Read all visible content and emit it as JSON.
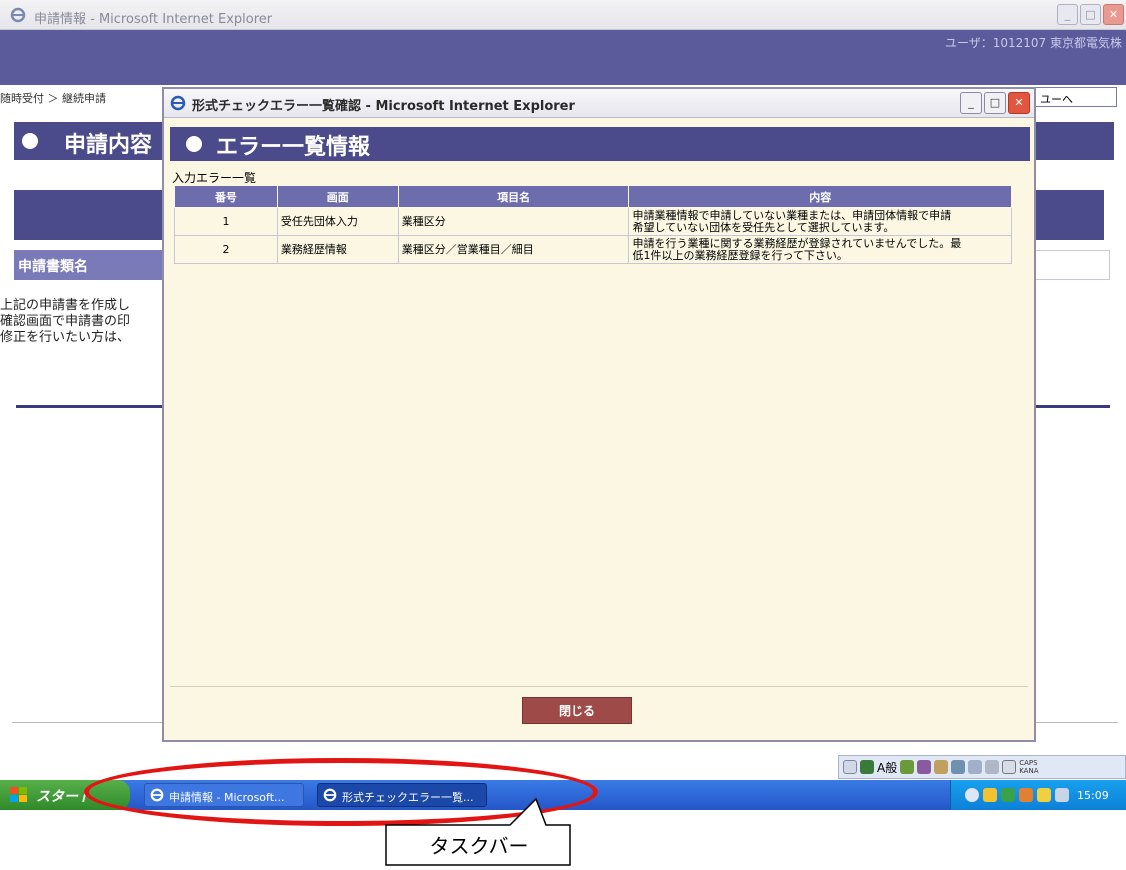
{
  "main_window": {
    "title": "申請情報 - Microsoft Internet Explorer",
    "user_info": "ユーザ：1012107 東京都電気株",
    "breadcrumb": "随時受付 ＞ 継続申請",
    "menu_button": "ユーへ",
    "section_title": "申請内容",
    "row_label": "申請書類名",
    "paragraph_lines": [
      "上記の申請書を作成し",
      "確認画面で申請書の印",
      "修正を行いたい方は、"
    ]
  },
  "dialog": {
    "title": "形式チェックエラー一覧確認 - Microsoft Internet Explorer",
    "header": "エラー一覧情報",
    "list_label": "入力エラー一覧",
    "columns": [
      "番号",
      "画面",
      "項目名",
      "内容"
    ],
    "rows": [
      {
        "no": "1",
        "screen": "受任先団体入力",
        "item": "業種区分",
        "content_lines": [
          "申請業種情報で申請していない業種または、申請団体情報で申請",
          "希望していない団体を受任先として選択しています。"
        ]
      },
      {
        "no": "2",
        "screen": "業務経歴情報",
        "item": "業種区分／営業種目／細目",
        "content_lines": [
          "申請を行う業種に関する業務経歴が登録されていませんでした。最",
          "低1件以上の業務経歴登録を行って下さい。"
        ]
      }
    ],
    "close_button": "閉じる"
  },
  "taskbar": {
    "start_label": "スタート",
    "tasks": [
      "申請情報 - Microsoft...",
      "形式チェックエラー一覧..."
    ],
    "clock": "15:09",
    "ime_text": "A般",
    "caps_kana": [
      "CAPS",
      "KANA"
    ]
  },
  "annotation": {
    "label": "タスクバー",
    "color": "#e31414"
  }
}
